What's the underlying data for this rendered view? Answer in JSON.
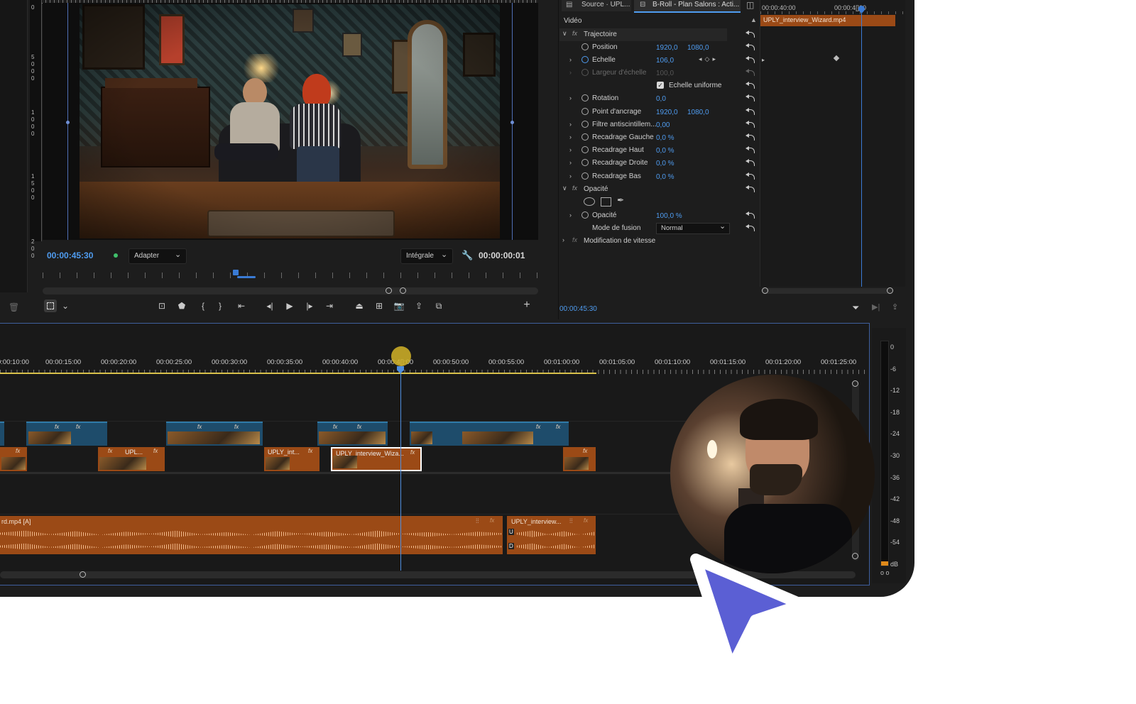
{
  "program_monitor": {
    "timecode": "00:00:45:30",
    "fit_label": "Adapter",
    "quality_label": "Intégrale",
    "duration": "00:00:00:01",
    "ruler_numbers": [
      "0",
      "5",
      "0",
      "0",
      "0",
      "1",
      "0",
      "0",
      "0",
      "1",
      "5",
      "0",
      "0",
      "2",
      "0",
      "0"
    ]
  },
  "effect_controls": {
    "tabs": [
      "Source · UPL...",
      "B-Roll - Plan Salons : Acti..."
    ],
    "section_video": "Vidéo",
    "motion_label": "Trajectoire",
    "position_label": "Position",
    "position_x": "1920,0",
    "position_y": "1080,0",
    "scale_label": "Echelle",
    "scale_value": "106,0",
    "scale_width_label": "Largeur d'échelle",
    "scale_width_value": "100,0",
    "uniform_scale_label": "Echelle uniforme",
    "rotation_label": "Rotation",
    "rotation_value": "0,0",
    "anchor_label": "Point d'ancrage",
    "anchor_x": "1920,0",
    "anchor_y": "1080,0",
    "flicker_label": "Filtre antiscintillem...",
    "flicker_value": "0,00",
    "crop_left_label": "Recadrage Gauche",
    "crop_left_value": "0,0 %",
    "crop_top_label": "Recadrage Haut",
    "crop_top_value": "0,0 %",
    "crop_right_label": "Recadrage Droite",
    "crop_right_value": "0,0 %",
    "crop_bottom_label": "Recadrage Bas",
    "crop_bottom_value": "0,0 %",
    "opacity_section_label": "Opacité",
    "opacity_label": "Opacité",
    "opacity_value": "100,0 %",
    "blend_label": "Mode de fusion",
    "blend_value": "Normal",
    "speed_label": "Modification de vitesse",
    "timecode": "00:00:45:30",
    "mini_ruler_start": "00:00:40:00",
    "mini_ruler_end": "00:00:4[]00",
    "clip_name": "UPLY_interview_Wizard.mp4"
  },
  "timeline": {
    "ruler_labels": [
      "0:00:10:00",
      "00:00:15:00",
      "00:00:20:00",
      "00:00:25:00",
      "00:00:30:00",
      "00:00:35:00",
      "00:00:40:00",
      "00:00:4[]:00",
      "00:00:50:00",
      "00:00:55:00",
      "00:01:00:00",
      "00:01:05:00",
      "00:01:10:00",
      "00:01:15:00",
      "00:01:20:00",
      "00:01:25:00"
    ],
    "clip_v1_b": "UPL...",
    "clip_v1_c": "UPLY_int...",
    "clip_v1_selected": "UPLY_interview_Wiza...",
    "fx_label": "fx",
    "audio_clip_a": "rd.mp4 [A]",
    "audio_clip_b": "UPLY_interview...",
    "audio_marker_1": "U",
    "audio_marker_2": "D"
  },
  "audio_meter": {
    "labels": [
      "0",
      "-6",
      "-12",
      "-18",
      "-24",
      "-30",
      "-36",
      "-42",
      "-48",
      "-54",
      "dB"
    ],
    "solo_label": "o o"
  },
  "colors": {
    "accent_blue": "#4f9cf0",
    "clip_orange": "#9b4a16",
    "clip_blue": "#1e4c6b",
    "cursor": "#5b5fd4",
    "playhead_marker": "#c9a227"
  }
}
